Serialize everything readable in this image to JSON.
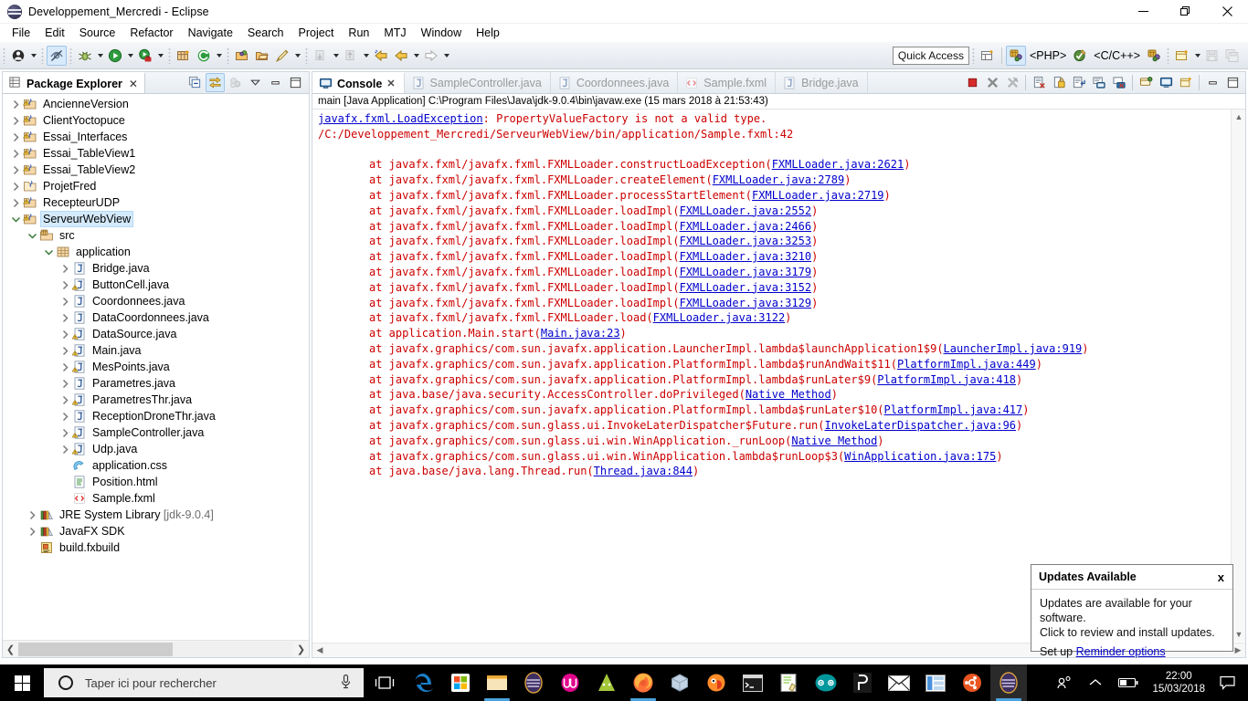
{
  "window": {
    "title": "Developpement_Mercredi - Eclipse",
    "minimize_label": "Minimize",
    "restore_label": "Restore",
    "close_label": "Close"
  },
  "menubar": {
    "items": [
      "File",
      "Edit",
      "Source",
      "Refactor",
      "Navigate",
      "Search",
      "Project",
      "Run",
      "MTJ",
      "Window",
      "Help"
    ]
  },
  "toolbar": {
    "quick_access_placeholder": "Quick Access",
    "quick_access_value": "",
    "perspective_php": "<PHP>",
    "perspective_cpp": "<C/C++>",
    "icons": [
      "new-wizard-icon",
      "toggle-mark-occurrences-icon",
      "debug-icon",
      "run-icon",
      "run-external-tools-icon",
      "new-java-package-icon",
      "refresh-icon",
      "open-type-icon",
      "open-task-icon",
      "pencil-icon",
      "skip-breakpoints-icon",
      "previous-annotation-icon",
      "next-annotation-icon",
      "back-icon",
      "forward-icon"
    ]
  },
  "package_explorer": {
    "tab_title": "Package Explorer",
    "tab_icon": "package-explorer-icon",
    "tools": [
      "collapse-all-icon",
      "link-with-editor-icon",
      "focus-on-active-task-icon",
      "view-menu-icon",
      "minimize-icon",
      "maximize-icon"
    ],
    "tree": [
      {
        "label": "AncienneVersion",
        "indent": 0,
        "icon": "java-project-warning-icon",
        "state": "collapsed"
      },
      {
        "label": "ClientYoctopuce",
        "indent": 0,
        "icon": "java-project-warning-icon",
        "state": "collapsed"
      },
      {
        "label": "Essai_Interfaces",
        "indent": 0,
        "icon": "java-project-warning-icon",
        "state": "collapsed"
      },
      {
        "label": "Essai_TableView1",
        "indent": 0,
        "icon": "java-project-warning-icon",
        "state": "collapsed"
      },
      {
        "label": "Essai_TableView2",
        "indent": 0,
        "icon": "java-project-warning-icon",
        "state": "collapsed"
      },
      {
        "label": "ProjetFred",
        "indent": 0,
        "icon": "project-closed-icon",
        "state": "collapsed"
      },
      {
        "label": "RecepteurUDP",
        "indent": 0,
        "icon": "java-project-warning-icon",
        "state": "collapsed"
      },
      {
        "label": "ServeurWebView",
        "indent": 0,
        "icon": "java-project-warning-icon",
        "state": "expanded",
        "selected": true
      },
      {
        "label": "src",
        "indent": 1,
        "icon": "source-folder-icon",
        "state": "expanded"
      },
      {
        "label": "application",
        "indent": 2,
        "icon": "package-icon",
        "state": "expanded"
      },
      {
        "label": "Bridge.java",
        "indent": 3,
        "icon": "java-file-icon",
        "state": "collapsed"
      },
      {
        "label": "ButtonCell.java",
        "indent": 3,
        "icon": "java-file-warning-icon",
        "state": "collapsed"
      },
      {
        "label": "Coordonnees.java",
        "indent": 3,
        "icon": "java-file-icon",
        "state": "collapsed"
      },
      {
        "label": "DataCoordonnees.java",
        "indent": 3,
        "icon": "java-file-icon",
        "state": "collapsed"
      },
      {
        "label": "DataSource.java",
        "indent": 3,
        "icon": "java-file-warning-icon",
        "state": "collapsed"
      },
      {
        "label": "Main.java",
        "indent": 3,
        "icon": "java-file-warning-icon",
        "state": "collapsed"
      },
      {
        "label": "MesPoints.java",
        "indent": 3,
        "icon": "java-file-warning-icon",
        "state": "collapsed"
      },
      {
        "label": "Parametres.java",
        "indent": 3,
        "icon": "java-file-icon",
        "state": "collapsed"
      },
      {
        "label": "ParametresThr.java",
        "indent": 3,
        "icon": "java-file-warning-icon",
        "state": "collapsed"
      },
      {
        "label": "ReceptionDroneThr.java",
        "indent": 3,
        "icon": "java-file-icon",
        "state": "collapsed"
      },
      {
        "label": "SampleController.java",
        "indent": 3,
        "icon": "java-file-warning-icon",
        "state": "collapsed"
      },
      {
        "label": "Udp.java",
        "indent": 3,
        "icon": "java-file-warning-icon",
        "state": "collapsed"
      },
      {
        "label": "application.css",
        "indent": 3,
        "icon": "css-file-icon",
        "state": "leaf"
      },
      {
        "label": "Position.html",
        "indent": 3,
        "icon": "html-file-icon",
        "state": "leaf"
      },
      {
        "label": "Sample.fxml",
        "indent": 3,
        "icon": "fxml-file-icon",
        "state": "leaf"
      },
      {
        "label": "JRE System Library",
        "sublabel": "[jdk-9.0.4]",
        "indent": 1,
        "icon": "library-icon",
        "state": "collapsed"
      },
      {
        "label": "JavaFX SDK",
        "indent": 1,
        "icon": "library-icon",
        "state": "collapsed"
      },
      {
        "label": "build.fxbuild",
        "indent": 1,
        "icon": "fxbuild-file-icon",
        "state": "leaf"
      }
    ]
  },
  "console": {
    "tabs": [
      {
        "label": "Console",
        "icon": "console-icon",
        "active": true,
        "closable": true
      },
      {
        "label": "SampleController.java",
        "icon": "java-file-icon",
        "active": false
      },
      {
        "label": "Coordonnees.java",
        "icon": "java-file-icon",
        "active": false
      },
      {
        "label": "Sample.fxml",
        "icon": "fxml-file-icon",
        "active": false
      },
      {
        "label": "Bridge.java",
        "icon": "java-file-icon",
        "active": false
      }
    ],
    "tools": [
      "terminate-icon",
      "remove-launch-icon",
      "remove-all-terminated-icon",
      "clear-console-icon",
      "scroll-lock-icon",
      "word-wrap-icon",
      "show-console-on-output-icon",
      "pin-console-icon",
      "display-selected-console-icon",
      "open-console-icon",
      "new-console-view-icon",
      "minimize-icon",
      "maximize-icon"
    ],
    "header": "main [Java Application] C:\\Program Files\\Java\\jdk-9.0.4\\bin\\javaw.exe (15 mars 2018 à 21:53:43)",
    "lines": [
      {
        "type": "exception",
        "link": "javafx.fxml.LoadException",
        "text": ": PropertyValueFactory is not a valid type."
      },
      {
        "type": "plain",
        "text": "/C:/Developpement_Mercredi/ServeurWebView/bin/application/Sample.fxml:42"
      },
      {
        "type": "blank",
        "text": ""
      },
      {
        "type": "at",
        "text": "at javafx.fxml/javafx.fxml.FXMLLoader.constructLoadException(",
        "link": "FXMLLoader.java:2621",
        "tail": ")"
      },
      {
        "type": "at",
        "text": "at javafx.fxml/javafx.fxml.FXMLLoader.createElement(",
        "link": "FXMLLoader.java:2789",
        "tail": ")"
      },
      {
        "type": "at",
        "text": "at javafx.fxml/javafx.fxml.FXMLLoader.processStartElement(",
        "link": "FXMLLoader.java:2719",
        "tail": ")"
      },
      {
        "type": "at",
        "text": "at javafx.fxml/javafx.fxml.FXMLLoader.loadImpl(",
        "link": "FXMLLoader.java:2552",
        "tail": ")"
      },
      {
        "type": "at",
        "text": "at javafx.fxml/javafx.fxml.FXMLLoader.loadImpl(",
        "link": "FXMLLoader.java:2466",
        "tail": ")"
      },
      {
        "type": "at",
        "text": "at javafx.fxml/javafx.fxml.FXMLLoader.loadImpl(",
        "link": "FXMLLoader.java:3253",
        "tail": ")"
      },
      {
        "type": "at",
        "text": "at javafx.fxml/javafx.fxml.FXMLLoader.loadImpl(",
        "link": "FXMLLoader.java:3210",
        "tail": ")"
      },
      {
        "type": "at",
        "text": "at javafx.fxml/javafx.fxml.FXMLLoader.loadImpl(",
        "link": "FXMLLoader.java:3179",
        "tail": ")"
      },
      {
        "type": "at",
        "text": "at javafx.fxml/javafx.fxml.FXMLLoader.loadImpl(",
        "link": "FXMLLoader.java:3152",
        "tail": ")"
      },
      {
        "type": "at",
        "text": "at javafx.fxml/javafx.fxml.FXMLLoader.loadImpl(",
        "link": "FXMLLoader.java:3129",
        "tail": ")"
      },
      {
        "type": "at",
        "text": "at javafx.fxml/javafx.fxml.FXMLLoader.load(",
        "link": "FXMLLoader.java:3122",
        "tail": ")"
      },
      {
        "type": "at",
        "text": "at application.Main.start(",
        "link": "Main.java:23",
        "tail": ")"
      },
      {
        "type": "at",
        "text": "at javafx.graphics/com.sun.javafx.application.LauncherImpl.lambda$launchApplication1$9(",
        "link": "LauncherImpl.java:919",
        "tail": ")"
      },
      {
        "type": "at",
        "text": "at javafx.graphics/com.sun.javafx.application.PlatformImpl.lambda$runAndWait$11(",
        "link": "PlatformImpl.java:449",
        "tail": ")"
      },
      {
        "type": "at",
        "text": "at javafx.graphics/com.sun.javafx.application.PlatformImpl.lambda$runLater$9(",
        "link": "PlatformImpl.java:418",
        "tail": ")"
      },
      {
        "type": "at",
        "text": "at java.base/java.security.AccessController.doPrivileged(",
        "link": "Native Method",
        "tail": ")"
      },
      {
        "type": "at",
        "text": "at javafx.graphics/com.sun.javafx.application.PlatformImpl.lambda$runLater$10(",
        "link": "PlatformImpl.java:417",
        "tail": ")"
      },
      {
        "type": "at",
        "text": "at javafx.graphics/com.sun.glass.ui.InvokeLaterDispatcher$Future.run(",
        "link": "InvokeLaterDispatcher.java:96",
        "tail": ")"
      },
      {
        "type": "at",
        "text": "at javafx.graphics/com.sun.glass.ui.win.WinApplication._runLoop(",
        "link": "Native Method",
        "tail": ")"
      },
      {
        "type": "at",
        "text": "at javafx.graphics/com.sun.glass.ui.win.WinApplication.lambda$runLoop$3(",
        "link": "WinApplication.java:175",
        "tail": ")"
      },
      {
        "type": "at",
        "text": "at java.base/java.lang.Thread.run(",
        "link": "Thread.java:844",
        "tail": ")"
      }
    ]
  },
  "notification": {
    "title": "Updates Available",
    "close_label": "x",
    "line1": "Updates are available for your software.",
    "line2": "Click to review and install updates.",
    "setup_prefix": "Set up",
    "setup_link": "Reminder options"
  },
  "taskbar": {
    "search_placeholder": "Taper ici pour rechercher",
    "start_icon": "windows-start-icon",
    "cortana_icon": "cortana-circle-icon",
    "mic_icon": "microphone-icon",
    "taskview_icon": "task-view-icon",
    "apps": [
      {
        "name": "edge-icon",
        "color": "#1a7ec8",
        "running": false
      },
      {
        "name": "microsoft-store-icon",
        "color": "#ffffff",
        "running": false
      },
      {
        "name": "file-explorer-icon",
        "color": "#ffc75a",
        "running": true
      },
      {
        "name": "eclipse-icon",
        "color": "#4b3a72",
        "running": false
      },
      {
        "name": "wamp-icon",
        "color": "#e3058d",
        "running": false
      },
      {
        "name": "android-studio-icon",
        "color": "#a4c639",
        "running": false
      },
      {
        "name": "firefox-icon",
        "color": "#ff7139",
        "running": true
      },
      {
        "name": "virtualbox-icon",
        "color": "#c3d3e3",
        "running": false
      },
      {
        "name": "filezilla-icon",
        "color": "#ff8c29",
        "running": false
      },
      {
        "name": "command-prompt-icon",
        "color": "#1c1c1c",
        "running": false
      },
      {
        "name": "notepad-plus-plus-icon",
        "color": "#8fd14f",
        "running": false
      },
      {
        "name": "arduino-icon",
        "color": "#00979d",
        "running": false
      },
      {
        "name": "processing-icon",
        "color": "#ffffff",
        "running": false
      },
      {
        "name": "mail-icon",
        "color": "#ffffff",
        "running": false
      },
      {
        "name": "vlc-or-app-icon",
        "color": "#4a90d9",
        "running": false
      },
      {
        "name": "ubuntu-icon",
        "color": "#e95420",
        "running": false
      },
      {
        "name": "eclipse-active-icon",
        "color": "#4b3a72",
        "running": true,
        "current": true
      }
    ],
    "tray": {
      "people_icon": "people-icon",
      "chevron_icon": "show-hidden-icons-icon",
      "battery_icon": "battery-icon",
      "time": "22:00",
      "date": "15/03/2018",
      "action_center_icon": "action-center-icon"
    }
  },
  "colors": {
    "error_red": "#cc0000",
    "link_blue": "#0000cc",
    "selection_blue": "#d4eafc",
    "toolbar_bg": "#eceff3",
    "taskbar_bg": "#000000"
  }
}
